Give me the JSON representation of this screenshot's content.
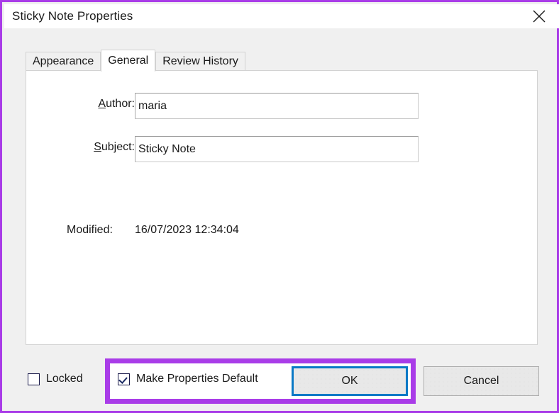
{
  "window": {
    "title": "Sticky Note Properties",
    "close_icon": "close-icon",
    "border_color": "#a93ce8"
  },
  "tabs": [
    {
      "label": "Appearance",
      "selected": false
    },
    {
      "label": "General",
      "selected": true
    },
    {
      "label": "Review History",
      "selected": false
    }
  ],
  "general_tab": {
    "author": {
      "label": "Author:",
      "accel": "A",
      "value": "maria",
      "placeholder": ""
    },
    "subject": {
      "label": "Subject:",
      "accel": "S",
      "value": "Sticky Note",
      "placeholder": ""
    },
    "modified": {
      "label": "Modified:",
      "value": "16/07/2023 12:34:04"
    }
  },
  "footer": {
    "locked": {
      "label": "Locked",
      "checked": false
    },
    "make_default": {
      "label": "Make Properties Default",
      "checked": true
    },
    "ok_button": {
      "label": "OK",
      "focused": true,
      "focus_color": "#0a79c6"
    },
    "cancel_button": {
      "label": "Cancel",
      "focused": false
    }
  },
  "annotation": {
    "highlight_color": "#a93ce8"
  }
}
